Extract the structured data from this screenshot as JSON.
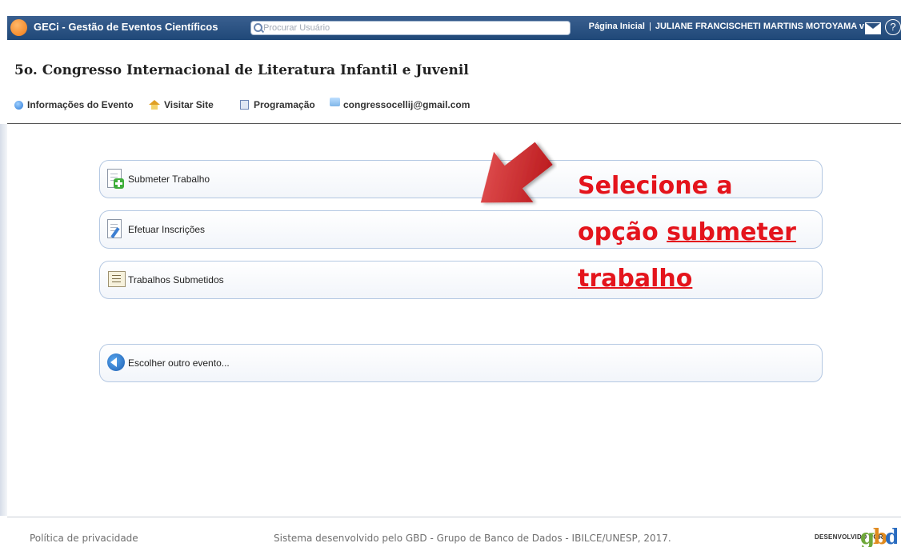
{
  "topbar": {
    "app_title": "GECi - Gestão de Eventos Científicos",
    "search_placeholder": "Procurar Usuário",
    "home_link": "Página Inicial",
    "separator": "|",
    "user_menu": "JULIANE FRANCISCHETI MARTINS MOTOYAMA v"
  },
  "event": {
    "title": "5o. Congresso Internacional de Literatura Infantil e Juvenil",
    "links": {
      "info": "Informações do Evento",
      "site": "Visitar Site",
      "program": "Programação",
      "email": "congressocellij@gmail.com"
    }
  },
  "options": [
    {
      "label": "Submeter Trabalho",
      "icon": "document-add-icon"
    },
    {
      "label": "Efetuar Inscrições",
      "icon": "document-edit-icon"
    },
    {
      "label": "Trabalhos Submetidos",
      "icon": "submitted-papers-icon"
    },
    {
      "label": "Escolher outro evento...",
      "icon": "back-arrow-icon"
    }
  ],
  "annotation": {
    "line1": "Selecione a",
    "line2_prefix": "opção ",
    "line2_underlined": "submeter",
    "line3_underlined": "trabalho",
    "color": "#e4141c"
  },
  "footer": {
    "privacy": "Política de privacidade",
    "credits": "Sistema desenvolvido pelo GBD - Grupo de Banco de Dados - IBILCE/UNESP, 2017.",
    "developed_by": "DESENVOLVIDO POR",
    "logo_text": "gbd"
  },
  "colors": {
    "topbar": "#2a5080",
    "card_border": "#b4c8e2",
    "annotation": "#e4141c"
  }
}
